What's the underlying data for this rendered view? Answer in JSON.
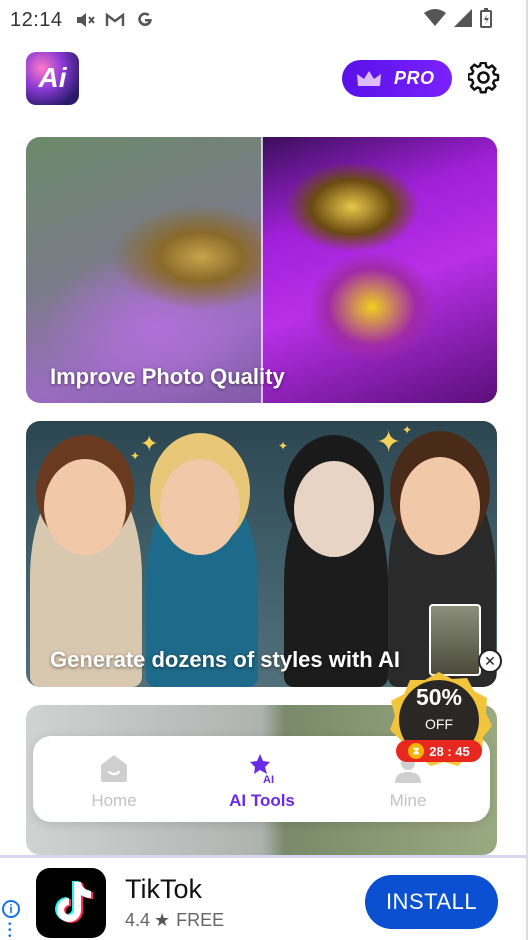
{
  "status_bar": {
    "time": "12:14",
    "icons": [
      "volume-off-icon",
      "gmail-icon",
      "google-icon",
      "wifi-icon",
      "signal-icon",
      "battery-icon"
    ]
  },
  "header": {
    "logo_text": "Ai",
    "pro_label": "PRO",
    "accent_color": "#6a1cf0"
  },
  "cards": [
    {
      "title": "Improve Photo Quality"
    },
    {
      "title": "Generate dozens of styles with AI"
    },
    {
      "title": ""
    }
  ],
  "promo": {
    "percent": "50%",
    "off": "OFF",
    "timer": "28 : 45"
  },
  "bottom_nav": {
    "items": [
      {
        "label": "Home",
        "icon": "home-icon",
        "active": false
      },
      {
        "label": "AI Tools",
        "icon": "ai-tools-icon",
        "active": true
      },
      {
        "label": "Mine",
        "icon": "person-icon",
        "active": false
      }
    ],
    "active_color": "#6a2be8",
    "inactive_color": "#c2c2c2"
  },
  "ad": {
    "app_name": "TikTok",
    "rating": "4.4",
    "price": "FREE",
    "install_label": "INSTALL",
    "button_color": "#0a50d0"
  }
}
